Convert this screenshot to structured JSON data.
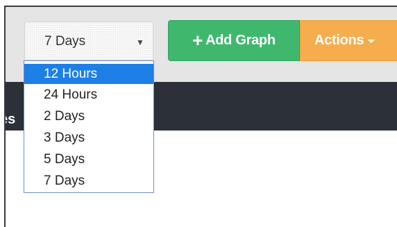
{
  "band_partial_text": "es",
  "time_select": {
    "value": "7 Days",
    "arrow_icon": "triangle-down-icon"
  },
  "toolbar": {
    "add_graph_label": "Add Graph",
    "add_graph_icon": "plus-icon",
    "actions_label": "Actions",
    "actions_icon": "caret-down-icon"
  },
  "dropdown": {
    "options": [
      "12 Hours",
      "24 Hours",
      "2 Days",
      "3 Days",
      "5 Days",
      "7 Days"
    ],
    "highlighted": "12 Hours"
  },
  "colors": {
    "add_graph_bg": "#3fb86e",
    "actions_bg": "#f5ad4e",
    "highlight_bg": "#1e7fe6",
    "dark_band_bg": "#2b3039",
    "toolbar_bg": "#e5e5e5"
  }
}
